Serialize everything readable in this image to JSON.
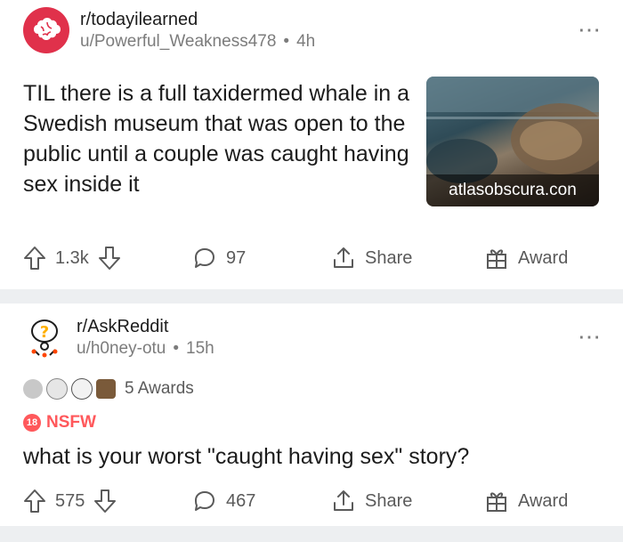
{
  "posts": [
    {
      "subreddit": "r/todayilearned",
      "author": "u/Powerful_Weakness478",
      "age": "4h",
      "title": "TIL there is a full taxidermed whale in a Swedish museum that was open to the public until a couple was caught having sex inside it",
      "thumbnail_caption": "atlasobscura.con",
      "votes": "1.3k",
      "comments": "97",
      "share_label": "Share",
      "award_label": "Award"
    },
    {
      "subreddit": "r/AskReddit",
      "author": "u/h0ney-otu",
      "age": "15h",
      "awards_label": "5 Awards",
      "nsfw_badge": "18",
      "nsfw_label": "NSFW",
      "title": "what is your worst \"caught having sex\" story?",
      "votes": "575",
      "comments": "467",
      "share_label": "Share",
      "award_label": "Award"
    }
  ],
  "colors": {
    "todayilearned_avatar": "#e0314b",
    "nsfw": "#ff585b",
    "separator": "#edeff1",
    "meta_text": "#7c7c7c"
  }
}
